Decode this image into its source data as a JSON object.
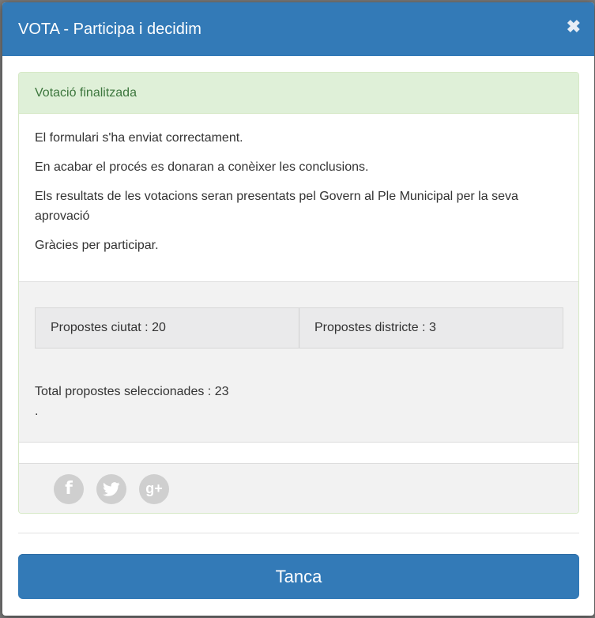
{
  "modal": {
    "title": "VOTA - Participa i decidim",
    "close_icon": "close-icon"
  },
  "panel": {
    "heading": "Votació finalitzada",
    "messages": [
      "El formulari s'ha enviat correctament.",
      "En acabar el procés es donaran a conèixer les conclusions.",
      "Els resultats de les votacions seran presentats pel Govern al Ple Municipal per la seva aprovació",
      "Gràcies per participar."
    ]
  },
  "summary": {
    "city_proposals": "Propostes ciutat : 20",
    "district_proposals": "Propostes districte : 3",
    "total": "Total propostes seleccionades : 23",
    "trailing_dot": "."
  },
  "share": {
    "icons": [
      "facebook-icon",
      "twitter-icon",
      "google-plus-icon"
    ],
    "facebook_glyph": "f",
    "google_glyph": "g+"
  },
  "footer": {
    "close_button": "Tanca"
  },
  "colors": {
    "header": "#337ab7",
    "panel_heading_bg": "#dff0d8",
    "panel_heading_text": "#3c763d",
    "button": "#337ab7"
  }
}
